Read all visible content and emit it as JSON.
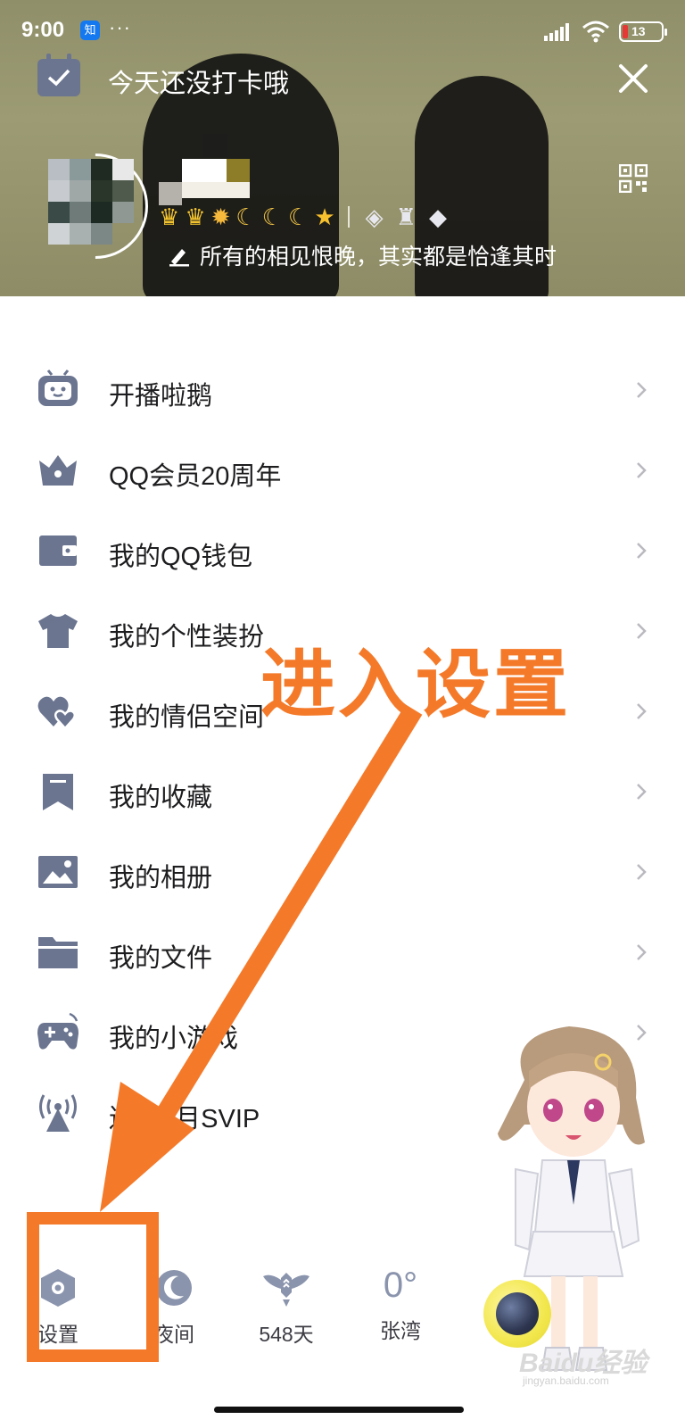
{
  "status_bar": {
    "time": "9:00",
    "app_badge": "知",
    "more": "···",
    "battery": "13"
  },
  "header": {
    "checkin_text": "今天还没打卡哦",
    "signature": "所有的相见恨晚，其实都是恰逢其时"
  },
  "menu": {
    "items": [
      {
        "label": "开播啦鹅",
        "icon": "tv-robot-icon"
      },
      {
        "label": "QQ会员20周年",
        "icon": "crown-icon"
      },
      {
        "label": "我的QQ钱包",
        "icon": "wallet-icon"
      },
      {
        "label": "我的个性装扮",
        "icon": "tshirt-icon"
      },
      {
        "label": "我的情侣空间",
        "icon": "hearts-icon"
      },
      {
        "label": "我的收藏",
        "icon": "bookmark-icon"
      },
      {
        "label": "我的相册",
        "icon": "photo-icon"
      },
      {
        "label": "我的文件",
        "icon": "folder-icon"
      },
      {
        "label": "我的小游戏",
        "icon": "gamepad-icon"
      },
      {
        "label": "送1个月SVIP",
        "icon": "broadcast-icon"
      }
    ]
  },
  "bottom_bar": {
    "settings_label": "设置",
    "night_label": "夜间",
    "days_label": "548天",
    "temperature": "0°",
    "location": "张湾"
  },
  "annotation": {
    "text": "进入设置"
  },
  "watermark": {
    "brand": "Baidu经验",
    "url": "jingyan.baidu.com"
  },
  "colors": {
    "accent_orange": "#f47a2a",
    "icon_gray": "#6b7590"
  }
}
